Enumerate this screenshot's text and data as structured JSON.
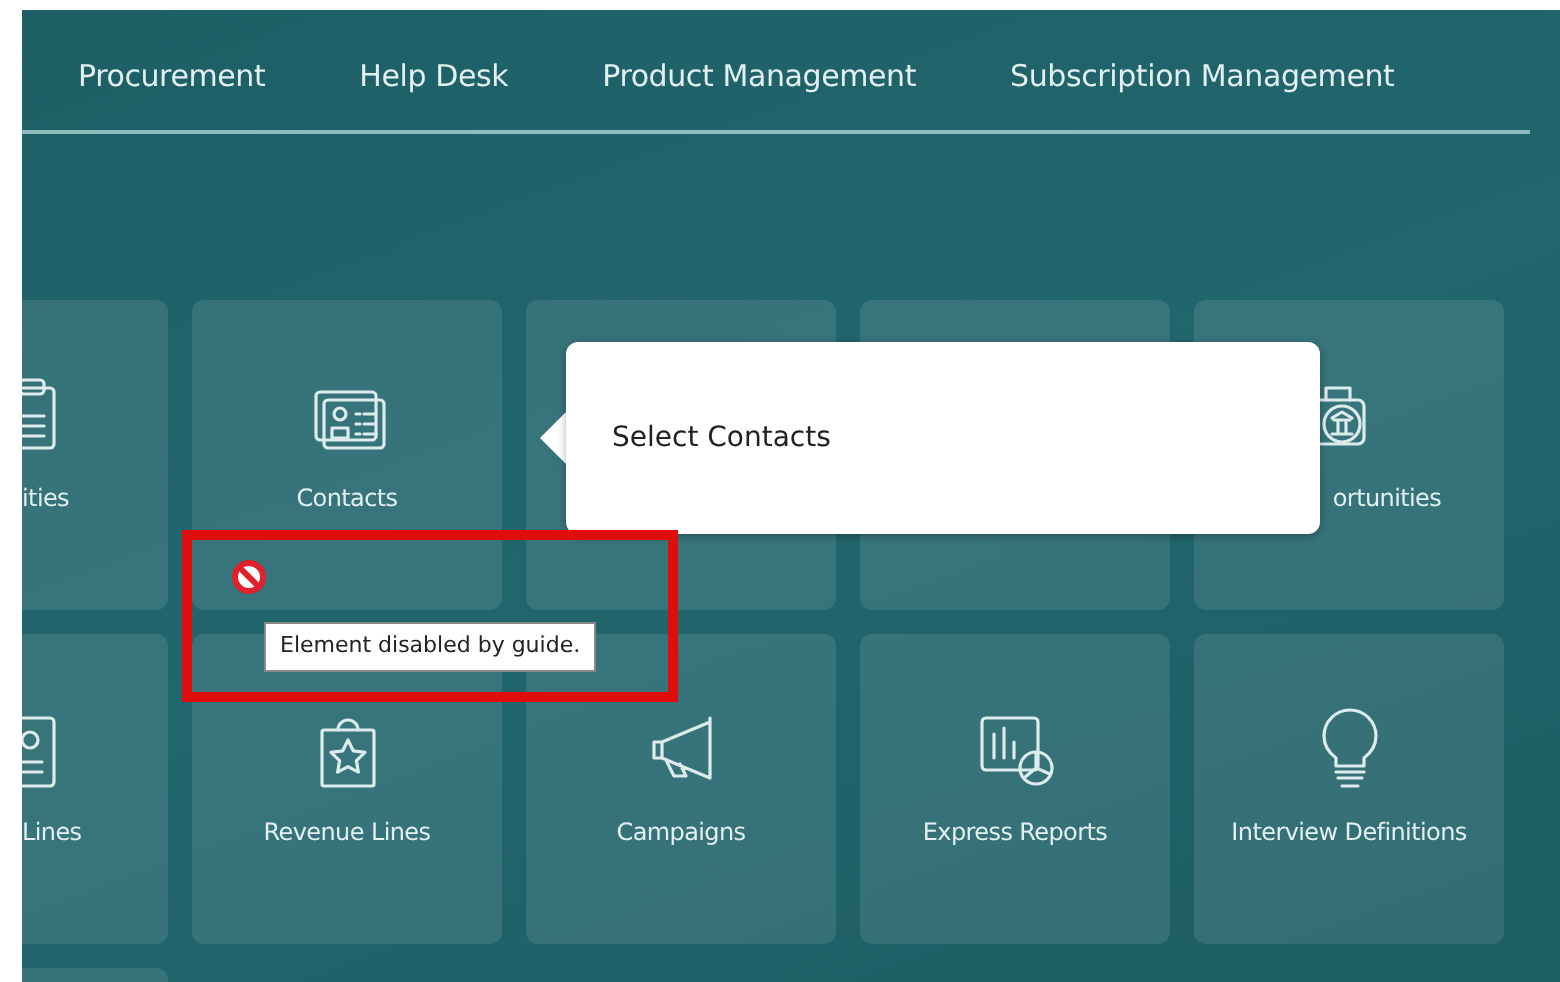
{
  "nav": {
    "items": [
      {
        "label": "Procurement"
      },
      {
        "label": "Help Desk"
      },
      {
        "label": "Product Management"
      },
      {
        "label": "Subscription Management"
      }
    ]
  },
  "tile_rows": [
    [
      {
        "label": "ities"
      },
      {
        "label": "Contacts"
      },
      {},
      {},
      {
        "label": "ortunities"
      }
    ],
    [
      {
        "label": "Lines"
      },
      {
        "label": "Revenue Lines"
      },
      {
        "label": "Campaigns"
      },
      {
        "label": "Express Reports"
      },
      {
        "label": "Interview Definitions"
      }
    ],
    [
      {}
    ]
  ],
  "guide_popup": {
    "text": "Select Contacts"
  },
  "disabled_hint": {
    "text": "Element disabled by guide."
  }
}
